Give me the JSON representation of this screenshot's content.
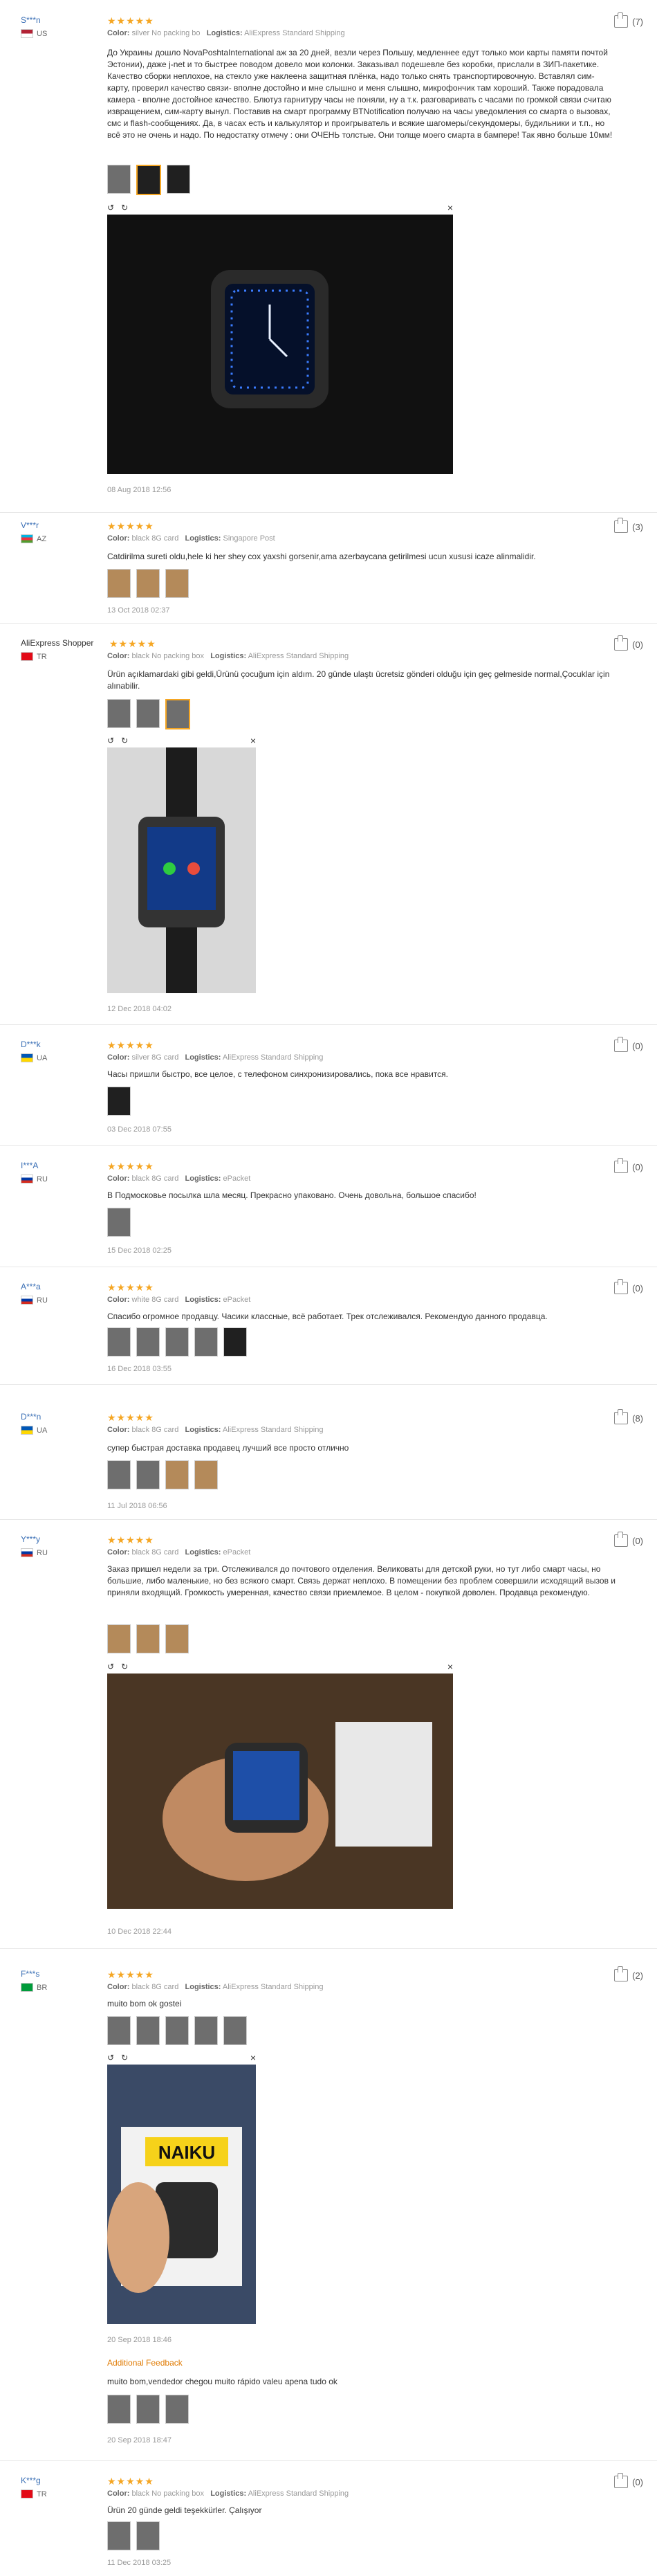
{
  "labels": {
    "color": "Color:",
    "logistics": "Logistics:",
    "additional_feedback": "Additional Feedback"
  },
  "viewer": {
    "rotate_left": "↺",
    "rotate_right": "↻",
    "close": "×"
  },
  "reviews": [
    {
      "user": "S***n",
      "country": "US",
      "stars": "★★★★★",
      "color": "silver No packing bo",
      "logistics": "AliExpress Standard Shipping",
      "text": "До Украины дошло NovaPoshtaInternational аж за 20 дней, везли через Польшу, медленнее едут только мои карты памяти почтой Эстонии), даже j-net и то быстрее поводом довело мои колонки. Заказывал подешевле без коробки, прислали в ЗИП-пакетике. Качество сборки неплохое, на стекло уже наклеена защитная плёнка, надо только снять транспортировочную. Вставлял сим-карту, проверил качество связи- вполне достойно и мне слышно и меня слышно, микрофончик там хороший. Также порадовала камера - вполне достойное качество. Блютуз гарнитуру часы не поняли, ну а т.к. разговаривать с часами по громкой связи считаю извращением, сим-карту вынул. Поставив на смарт программу BTNotification получаю на часы уведомления со смарта о вызовах, смс и flash-сообщениях. Да, в часах есть и калькулятор и проигрыватель и всякие шагомеры/секундомеры, будильники и т.п., но всё это не очень и надо. По недостатку отмечу : они ОЧЕНЬ толстые. Они толще моего смарта в бампере! Так явно больше 10мм!",
      "date": "08 Aug 2018 12:56",
      "helpful": "(7)"
    },
    {
      "user": "V***r",
      "country": "AZ",
      "stars": "★★★★★",
      "color": "black 8G card",
      "logistics": "Singapore Post",
      "text": "Catdirilma sureti oldu,hele ki her shey cox yaxshi gorsenir,ama azerbaycana getirilmesi ucun xususi icaze alinmalidir.",
      "date": "13 Oct 2018 02:37",
      "helpful": "(3)"
    },
    {
      "user": "AliExpress Shopper",
      "country": "TR",
      "stars": "★★★★★",
      "color": "black No packing box",
      "logistics": "AliExpress Standard Shipping",
      "text": "Ürün açıklamardaki gibi geldi,Ürünü çocuğum için aldım. 20 günde ulaştı ücretsiz gönderi olduğu için geç gelmeside normal,Çocuklar için alınabilir.",
      "date": "12 Dec 2018 04:02",
      "helpful": "(0)"
    },
    {
      "user": "D***k",
      "country": "UA",
      "stars": "★★★★★",
      "color": "silver 8G card",
      "logistics": "AliExpress Standard Shipping",
      "text": "Часы пришли быстро, все целое, с телефоном синхронизировались, пока все нравится.",
      "date": "03 Dec 2018 07:55",
      "helpful": "(0)"
    },
    {
      "user": "I***A",
      "country": "RU",
      "stars": "★★★★★",
      "color": "black 8G card",
      "logistics": "ePacket",
      "text": "В Подмосковье посылка шла месяц. Прекрасно упаковано. Очень довольна, большое спасибо!",
      "date": "15 Dec 2018 02:25",
      "helpful": "(0)"
    },
    {
      "user": "A***a",
      "country": "RU",
      "stars": "★★★★★",
      "color": "white 8G card",
      "logistics": "ePacket",
      "text": "Спасибо огромное продавцу. Часики классные, всё работает. Трек отслеживался. Рекомендую данного продавца.",
      "date": "16 Dec 2018 03:55",
      "helpful": "(0)"
    },
    {
      "user": "D***n",
      "country": "UA",
      "stars": "★★★★★",
      "color": "black 8G card",
      "logistics": "AliExpress Standard Shipping",
      "text": "супер быстрая доставка продавец лучший все просто отлично",
      "date": "11 Jul 2018 06:56",
      "helpful": "(8)"
    },
    {
      "user": "Y***y",
      "country": "RU",
      "stars": "★★★★★",
      "color": "black 8G card",
      "logistics": "ePacket",
      "text": "Заказ пришел недели за три. Отслеживался до почтового отделения. Великоваты для детской руки, но тут либо смарт часы, но большие, либо маленькие, но без всякого смарт. Связь держат неплохо. В помещении без проблем совершили исходящий вызов и приняли входящий. Громкость умеренная, качество связи приемлемое. В целом - покупкой доволен. Продавца рекомендую.",
      "date": "10 Dec 2018 22:44",
      "helpful": "(0)"
    },
    {
      "user": "F***s",
      "country": "BR",
      "stars": "★★★★★",
      "color": "black 8G card",
      "logistics": "AliExpress Standard Shipping",
      "text": "muito bom ok gostei",
      "date": "20 Sep 2018 18:46",
      "additional_text": "muito bom,vendedor chegou muito rápido valeu apena tudo ok",
      "additional_date": "20 Sep 2018 18:47",
      "photo_brand": "NAIKU",
      "helpful": "(2)"
    },
    {
      "user": "K***g",
      "country": "TR",
      "stars": "★★★★★",
      "color": "black No packing box",
      "logistics": "AliExpress Standard Shipping",
      "text": "Ürün 20 günde geldi teşekkürler. Çalışıyor",
      "date": "11 Dec 2018 03:25",
      "helpful": "(0)"
    }
  ]
}
